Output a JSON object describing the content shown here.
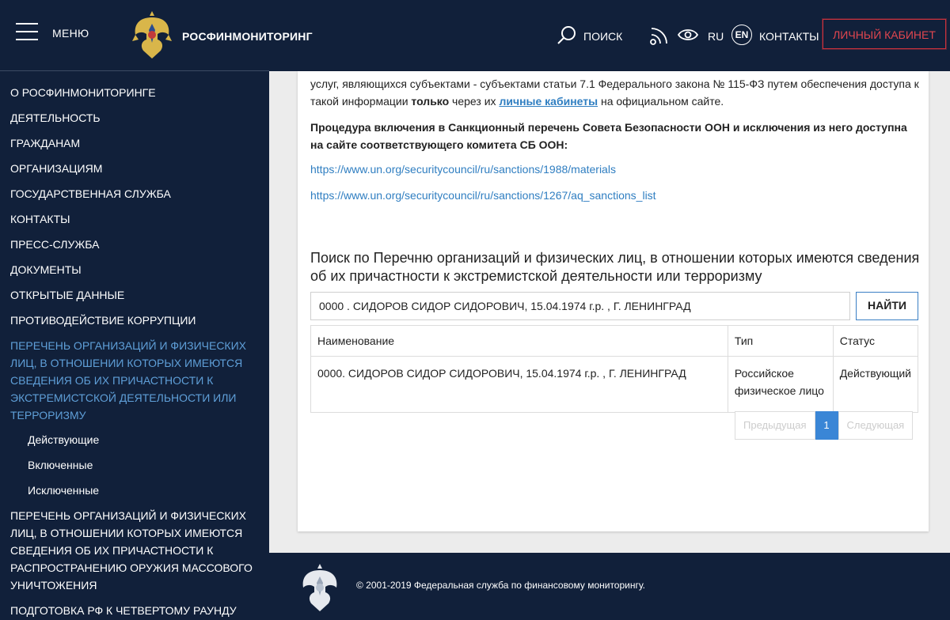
{
  "header": {
    "menu_label": "МЕНЮ",
    "brand": "РОСФИНМОНИТОРИНГ",
    "search_label": "ПОИСК",
    "lang_ru": "RU",
    "lang_en": "EN",
    "contacts_label": "КОНТАКТЫ",
    "cabinet_label": "ЛИЧНЫЙ КАБИНЕТ"
  },
  "sidebar": {
    "items": [
      "О РОСФИНМОНИТОРИНГЕ",
      "ДЕЯТЕЛЬНОСТЬ",
      "ГРАЖДАНАМ",
      "ОРГАНИЗАЦИЯМ",
      "ГОСУДАРСТВЕННАЯ СЛУЖБА",
      "КОНТАКТЫ",
      "ПРЕСС-СЛУЖБА",
      "ДОКУМЕНТЫ",
      "ОТКРЫТЫЕ ДАННЫЕ",
      "ПРОТИВОДЕЙСТВИЕ КОРРУПЦИИ"
    ],
    "active_item": "ПЕРЕЧЕНЬ ОРГАНИЗАЦИЙ И ФИЗИЧЕСКИХ ЛИЦ, В ОТНОШЕНИИ КОТОРЫХ ИМЕЮТСЯ СВЕДЕНИЯ ОБ ИХ ПРИЧАСТНОСТИ К ЭКСТРЕМИСТСКОЙ ДЕЯТЕЛЬНОСТИ ИЛИ ТЕРРОРИЗМУ",
    "sub_items": [
      "Действующие",
      "Включенные",
      "Исключенные"
    ],
    "item_wmd": "ПЕРЕЧЕНЬ ОРГАНИЗАЦИЙ И ФИЗИЧЕСКИХ ЛИЦ, В ОТНОШЕНИИ КОТОРЫХ ИМЕЮТСЯ СВЕДЕНИЯ ОБ ИХ ПРИЧАСТНОСТИ К РАСПРОСТРАНЕНИЮ ОРУЖИЯ МАССОВОГО УНИЧТОЖЕНИЯ",
    "item_last": "ПОДГОТОВКА РФ К ЧЕТВЕРТОМУ РАУНДУ"
  },
  "main": {
    "para1_part1": "услуг, являющихся субъектами  - субъектами статьи 7.1 Федерального закона № 115-ФЗ путем обеспечения доступа к такой информации ",
    "para1_bold": "только",
    "para1_part2": " через их ",
    "para1_link": "личные кабинеты",
    "para1_part3": " на официальном сайте.",
    "para2": "Процедура включения в Санкционный перечень Совета Безопасности ООН и исключения из него доступна на сайте соответствующего комитета СБ ООН:",
    "link1": "https://www.un.org/securitycouncil/ru/sanctions/1988/materials",
    "link2": "https://www.un.org/securitycouncil/ru/sanctions/1267/aq_sanctions_list",
    "search_title": "Поиск по Перечню организаций и физических лиц, в отношении которых имеются сведения об их причастности к экстремистской деятельности или терроризму",
    "search_value": "0000 . СИДОРОВ СИДОР СИДОРОВИЧ, 15.04.1974 г.р. , Г. ЛЕНИНГРАД",
    "find_label": "НАЙТИ",
    "table": {
      "headers": [
        "Наименование",
        "Тип",
        "Статус"
      ],
      "rows": [
        [
          "0000. СИДОРОВ СИДОР СИДОРОВИЧ, 15.04.1974 г.р. , Г. ЛЕНИНГРАД",
          "Российское физическое лицо",
          "Действующий"
        ]
      ]
    },
    "pagination": {
      "prev": "Предыдущая",
      "current": "1",
      "next": "Следующая"
    }
  },
  "footer": {
    "copyright": "© 2001-2019 Федеральная служба по финансовому мониторингу."
  },
  "colors": {
    "navy": "#11203a",
    "accent_blue": "#3a86d6",
    "link_blue": "#2f7ec1",
    "cabinet_red": "#e0464f",
    "active_nav": "#5f9fd8"
  }
}
